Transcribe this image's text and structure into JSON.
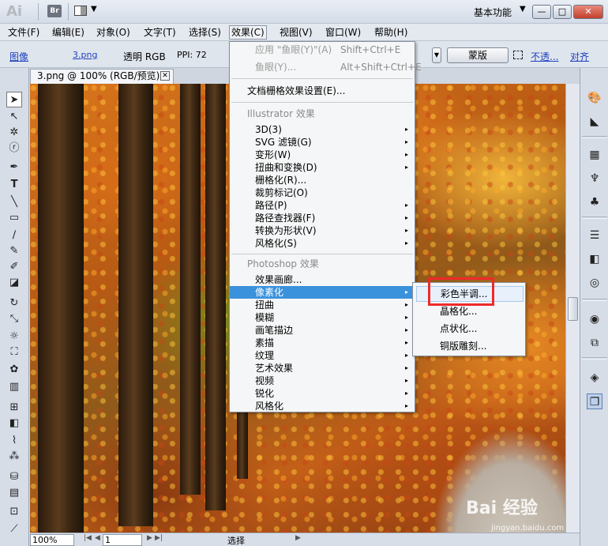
{
  "titlebar": {
    "app_logo": "Ai",
    "bridge": "Br",
    "workspace": "基本功能",
    "min": "—",
    "max": "□",
    "close": "✕"
  },
  "menubar": [
    {
      "label": "文件(F)"
    },
    {
      "label": "编辑(E)"
    },
    {
      "label": "对象(O)"
    },
    {
      "label": "文字(T)"
    },
    {
      "label": "选择(S)"
    },
    {
      "label": "效果(C)"
    },
    {
      "label": "视图(V)"
    },
    {
      "label": "窗口(W)"
    },
    {
      "label": "帮助(H)"
    }
  ],
  "controlbar": {
    "image_label": "图像",
    "filename": "3.png",
    "mode": "透明 RGB",
    "ppi": "PPI: 72",
    "mask_button": "蒙版",
    "opacity_link": "不透...",
    "align_link": "对齐"
  },
  "document_tab": {
    "title": "3.png @ 100% (RGB/预览)",
    "close": "✕"
  },
  "effect_menu": {
    "apply_last": {
      "label": "应用 \"鱼眼(Y)\"(A)",
      "shortcut": "Shift+Ctrl+E"
    },
    "last_effect": {
      "label": "鱼眼(Y)...",
      "shortcut": "Alt+Shift+Ctrl+E"
    },
    "raster_settings": "文档栅格效果设置(E)...",
    "illustrator_section": "Illustrator 效果",
    "illustrator_items": [
      {
        "label": "3D(3)",
        "submenu": true
      },
      {
        "label": "SVG 滤镜(G)",
        "submenu": true
      },
      {
        "label": "变形(W)",
        "submenu": true
      },
      {
        "label": "扭曲和变换(D)",
        "submenu": true
      },
      {
        "label": "栅格化(R)...",
        "submenu": false
      },
      {
        "label": "裁剪标记(O)",
        "submenu": false
      },
      {
        "label": "路径(P)",
        "submenu": true
      },
      {
        "label": "路径查找器(F)",
        "submenu": true
      },
      {
        "label": "转换为形状(V)",
        "submenu": true
      },
      {
        "label": "风格化(S)",
        "submenu": true
      }
    ],
    "photoshop_section": "Photoshop 效果",
    "photoshop_items": [
      {
        "label": "效果画廊...",
        "submenu": false
      },
      {
        "label": "像素化",
        "submenu": true
      },
      {
        "label": "扭曲",
        "submenu": true
      },
      {
        "label": "模糊",
        "submenu": true
      },
      {
        "label": "画笔描边",
        "submenu": true
      },
      {
        "label": "素描",
        "submenu": true
      },
      {
        "label": "纹理",
        "submenu": true
      },
      {
        "label": "艺术效果",
        "submenu": true
      },
      {
        "label": "视频",
        "submenu": true
      },
      {
        "label": "锐化",
        "submenu": true
      },
      {
        "label": "风格化",
        "submenu": true
      }
    ]
  },
  "pixelate_submenu": [
    {
      "label": "彩色半调..."
    },
    {
      "label": "晶格化..."
    },
    {
      "label": "点状化..."
    },
    {
      "label": "铜版雕刻..."
    }
  ],
  "statusbar": {
    "zoom": "100%",
    "page": "1",
    "tool": "选择"
  },
  "watermark": {
    "brand": "Bai 经验",
    "url": "jingyan.baidu.com"
  },
  "icons": {
    "arrow": "▸",
    "dropdown": "▼"
  }
}
